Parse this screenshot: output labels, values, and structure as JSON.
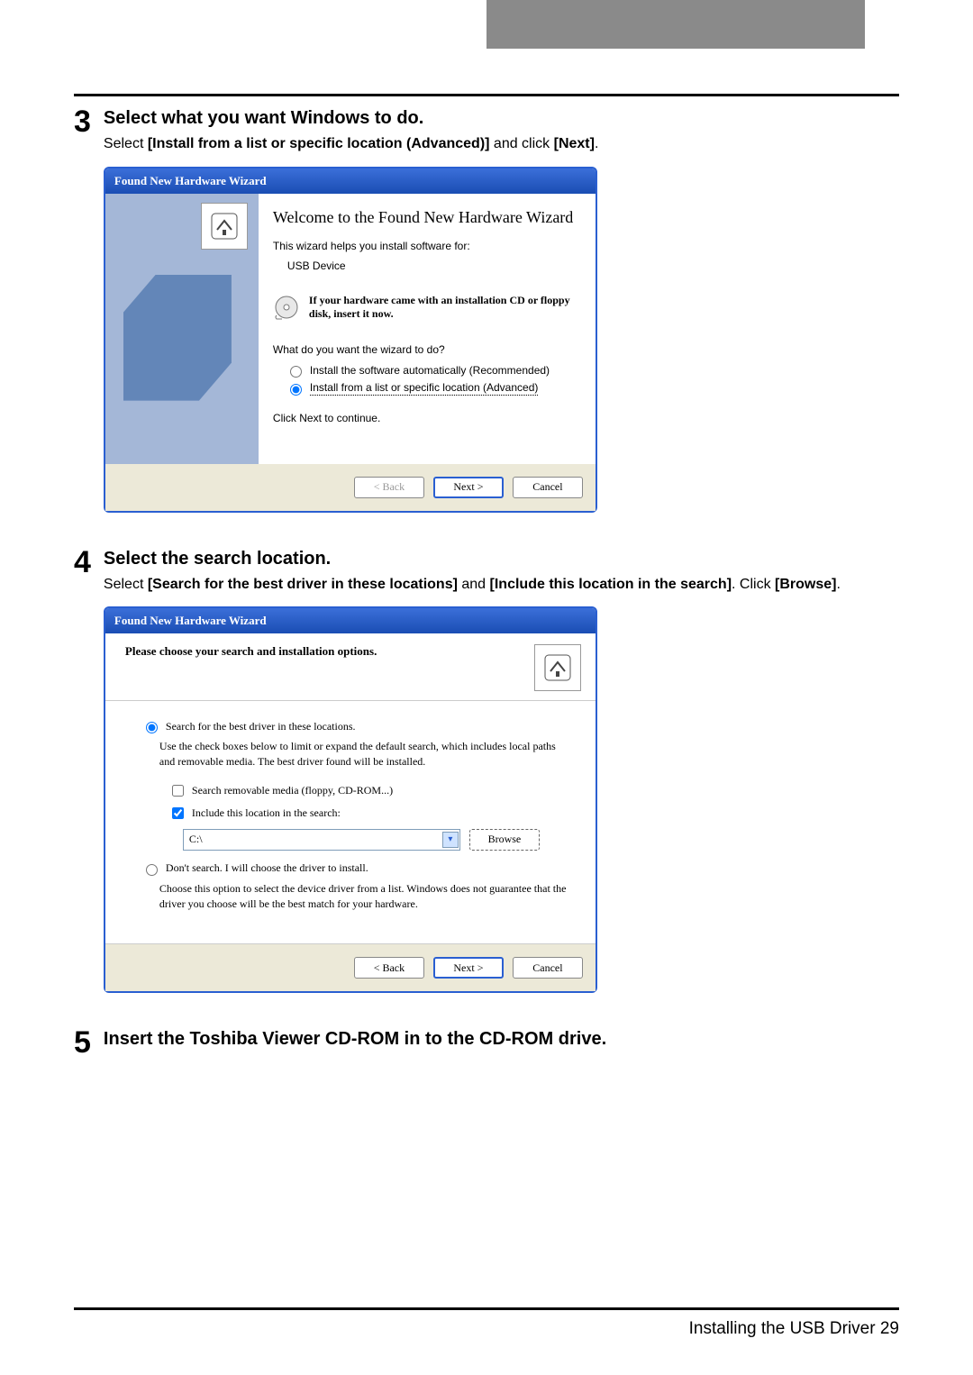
{
  "step3": {
    "num": "3",
    "title": "Select what you want Windows to do.",
    "desc_a": "Select ",
    "desc_b": "[Install from a list or specific location (Advanced)]",
    "desc_c": " and click ",
    "desc_d": "[Next]",
    "desc_e": "."
  },
  "wizard1": {
    "title": "Found New Hardware Wizard",
    "welcome": "Welcome to the Found New Hardware Wizard",
    "helps": "This wizard helps you install software for:",
    "device": "USB Device",
    "cd_hint": "If your hardware came with an installation CD or floppy disk, insert it now.",
    "question": "What do you want the wizard to do?",
    "radio_auto": "Install the software automatically (Recommended)",
    "radio_adv": "Install from a list or specific location (Advanced)",
    "click_next": "Click Next to continue.",
    "back": "< Back",
    "next": "Next >",
    "cancel": "Cancel"
  },
  "step4": {
    "num": "4",
    "title": "Select the search location.",
    "desc_a": "Select ",
    "desc_b": "[Search for the best driver in these locations]",
    "desc_c": " and ",
    "desc_d": "[Include this location in the search]",
    "desc_e": ". Click ",
    "desc_f": "[Browse]",
    "desc_g": "."
  },
  "wizard2": {
    "title": "Found New Hardware Wizard",
    "header": "Please choose your search and installation options.",
    "radio_search": "Search for the best driver in these locations.",
    "search_desc": "Use the check boxes below to limit or expand the default search, which includes local paths and removable media. The best driver found will be installed.",
    "chk_removable": "Search removable media (floppy, CD-ROM...)",
    "chk_include": "Include this location in the search:",
    "path": "C:\\",
    "browse": "Browse",
    "radio_dont": "Don't search. I will choose the driver to install.",
    "dont_desc": "Choose this option to select the device driver from a list.  Windows does not guarantee that the driver you choose will be the best match for your hardware.",
    "back": "< Back",
    "next": "Next >",
    "cancel": "Cancel"
  },
  "step5": {
    "num": "5",
    "title": "Insert the Toshiba Viewer CD-ROM in to the CD-ROM drive."
  },
  "pagefoot": {
    "text": "Installing the USB Driver    29"
  }
}
